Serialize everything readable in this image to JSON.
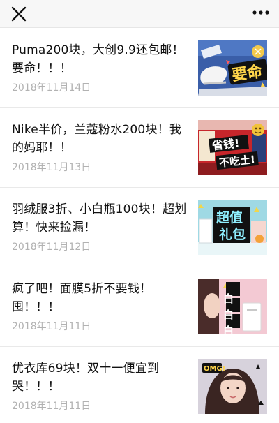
{
  "topbar": {
    "close_icon": "close-icon",
    "more_icon": "more-dots-icon"
  },
  "articles": [
    {
      "title": "Puma200块，大创9.9还包邮！要命！！！",
      "date": "2018年11月14日",
      "thumb_text": "要命",
      "thumb_icon": "sneaker-thumbnail"
    },
    {
      "title": "Nike半价，兰蔻粉水200块！我的妈耶！！",
      "date": "2018年11月13日",
      "thumb_text_1": "省钱!",
      "thumb_text_2": "不吃土!",
      "thumb_icon": "sale-thumbnail"
    },
    {
      "title": "羽绒服3折、小白瓶100块！超划算！快来捡漏！",
      "date": "2018年11月12日",
      "thumb_text_1": "超值",
      "thumb_text_2": "礼包",
      "thumb_icon": "gift-thumbnail"
    },
    {
      "title": "疯了吧！面膜5折不要钱！囤！！！",
      "date": "2018年11月11日",
      "thumb_text": "白白白",
      "thumb_icon": "facemask-thumbnail"
    },
    {
      "title": "优衣库69块！双十一便宜到哭！！！",
      "date": "2018年11月11日",
      "thumb_text": "OMG!",
      "thumb_icon": "portrait-thumbnail"
    }
  ]
}
